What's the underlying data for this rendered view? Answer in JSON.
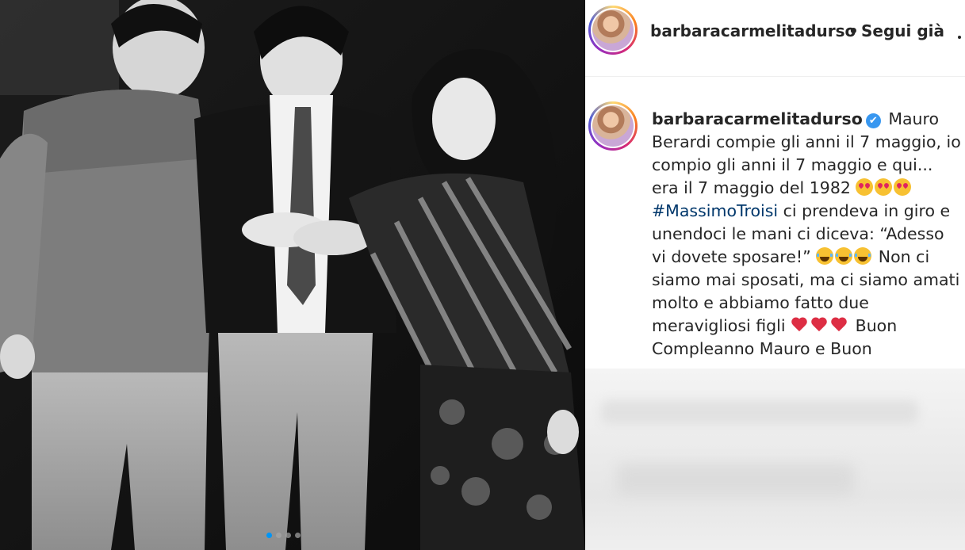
{
  "header": {
    "username": "barbaracarmelitadurso",
    "separator": "•",
    "follow_label": "Segui già"
  },
  "caption": {
    "username": "barbaracarmelitadurso",
    "verified_icon": "✔",
    "text_part1": "Mauro Berardi compie gli anni il 7 maggio, io compio gli anni il 7 maggio e qui... era il 7 maggio del 1982",
    "hashtag": "#MassimoTroisi",
    "text_part2": "ci prendeva in giro e unendoci le mani ci diceva: “Adesso vi dovete sposare!”",
    "text_part3": "Non ci siamo mai sposati, ma ci siamo amati molto e abbiamo fatto due meravigliosi figli",
    "text_part4": "Buon Compleanno Mauro e Buon"
  },
  "carousel": {
    "dot_count": 4,
    "active_index": 0
  },
  "colors": {
    "accent": "#0095f6",
    "verified": "#3897f0",
    "hashtag": "#00376b",
    "text": "#262626"
  },
  "icons": {
    "more": "more-options-icon",
    "verified": "verified-badge-icon"
  }
}
